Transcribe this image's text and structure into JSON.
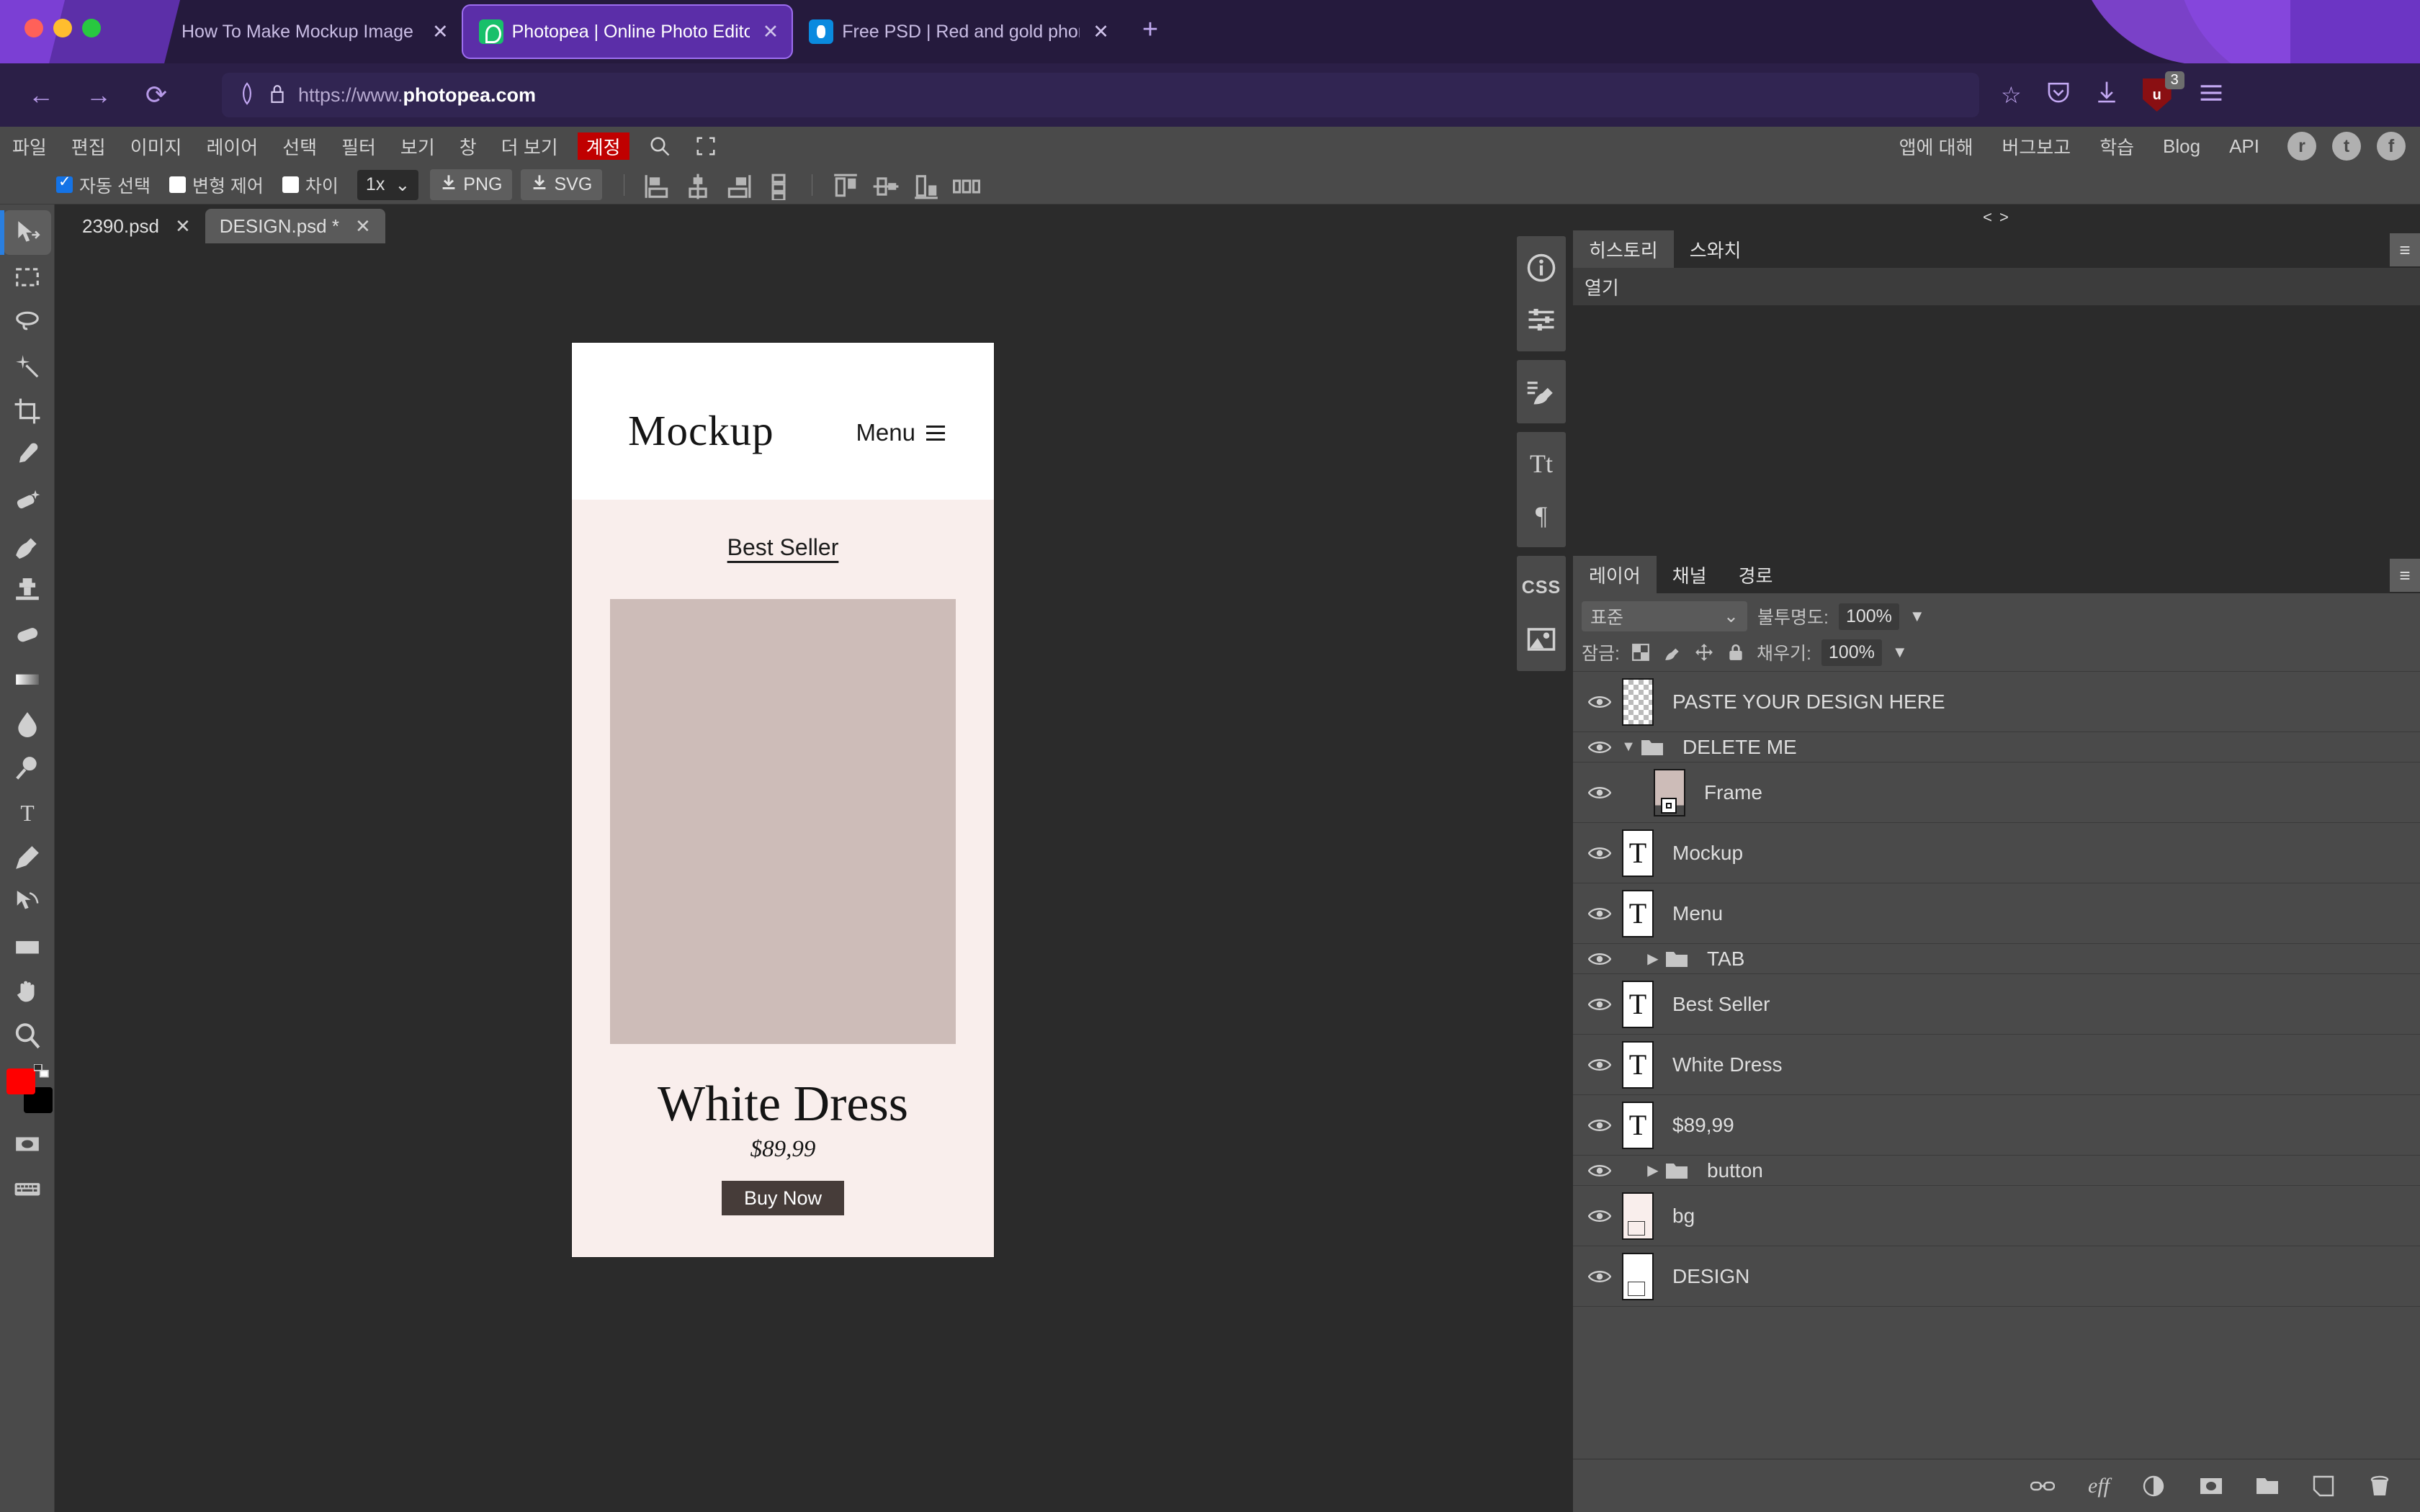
{
  "browser": {
    "tabs": [
      {
        "title": "How To Make Mockup Image · Devle",
        "favicon": "none",
        "active": false,
        "close": "✕"
      },
      {
        "title": "Photopea | Online Photo Editor",
        "favicon": "photopea-icon",
        "active": true,
        "close": "✕"
      },
      {
        "title": "Free PSD | Red and gold phone s",
        "favicon": "freepik-icon",
        "active": false,
        "close": "✕"
      }
    ],
    "new_tab_label": "+",
    "nav": {
      "back": "←",
      "forward": "→",
      "reload": "⟳"
    },
    "url": {
      "prefix": "https://www.",
      "domain": "photopea.com",
      "shield_icon": "tracking-shield-icon",
      "lock_icon": "lock-icon"
    },
    "toolbar_right": {
      "bookmark": "☆",
      "pocket": "pocket-icon",
      "download": "download-icon",
      "ublock_label": "u",
      "ublock_badge": "3",
      "menu": "hamburger-menu-icon"
    }
  },
  "photopea": {
    "menubar": {
      "items": [
        "파일",
        "편집",
        "이미지",
        "레이어",
        "선택",
        "필터",
        "보기",
        "창",
        "더 보기"
      ],
      "account": "계정",
      "search_icon": "search-icon",
      "fullscreen_icon": "fullscreen-icon",
      "right_links": [
        "앱에 대해",
        "버그보고",
        "학습",
        "Blog",
        "API"
      ],
      "social": [
        "reddit-icon",
        "twitter-icon",
        "facebook-icon"
      ]
    },
    "options": {
      "auto_select": {
        "label": "자동 선택",
        "checked": true
      },
      "transform_controls": {
        "label": "변형 제어",
        "checked": false
      },
      "difference": {
        "label": "차이",
        "checked": false
      },
      "scale": "1x",
      "export_png": "PNG",
      "export_svg": "SVG"
    },
    "doc_tabs": [
      {
        "name": "2390.psd",
        "active": false,
        "close": "✕"
      },
      {
        "name": "DESIGN.psd *",
        "active": true,
        "close": "✕"
      }
    ],
    "tools": [
      "move-tool",
      "marquee-tool",
      "lasso-tool",
      "magic-wand-tool",
      "crop-tool",
      "eyedropper-tool",
      "healing-brush-tool",
      "brush-tool",
      "clone-stamp-tool",
      "eraser-tool",
      "gradient-tool",
      "blur-tool",
      "dodge-tool",
      "type-tool",
      "pen-tool",
      "path-selection-tool",
      "rectangle-tool",
      "hand-tool",
      "zoom-tool"
    ],
    "swatches": {
      "foreground": "#ff0000",
      "background": "#000000"
    },
    "rail_icons": [
      "info-icon",
      "adjustments-icon",
      "brush-settings-icon",
      "character-icon",
      "paragraph-icon",
      "css-icon",
      "image-icon"
    ],
    "history_panel": {
      "tabs": [
        {
          "label": "히스토리",
          "active": true
        },
        {
          "label": "스와치",
          "active": false
        }
      ],
      "menu_icon": "panel-menu-icon",
      "items": [
        "열기"
      ]
    },
    "layers_panel": {
      "tabs": [
        {
          "label": "레이어",
          "active": true
        },
        {
          "label": "채널",
          "active": false
        },
        {
          "label": "경로",
          "active": false
        }
      ],
      "menu_icon": "panel-menu-icon",
      "blend_mode": "표준",
      "opacity_label": "불투명도:",
      "opacity_value": "100%",
      "lock_label": "잠금:",
      "lock_icons": [
        "lock-transparency-icon",
        "lock-pixels-icon",
        "lock-position-icon",
        "lock-all-icon"
      ],
      "fill_label": "채우기:",
      "fill_value": "100%",
      "layers": [
        {
          "name": "PASTE YOUR DESIGN HERE",
          "type": "raster",
          "thumb": "checker",
          "visible": true,
          "kind": "layer"
        },
        {
          "name": "DELETE ME",
          "type": "group",
          "expanded": true,
          "visible": true,
          "kind": "group"
        },
        {
          "name": "Frame",
          "type": "smart",
          "thumb": "frame",
          "visible": true,
          "kind": "layer",
          "indent": true
        },
        {
          "name": "Mockup",
          "type": "text",
          "thumb": "T",
          "visible": true,
          "kind": "layer"
        },
        {
          "name": "Menu",
          "type": "text",
          "thumb": "T",
          "visible": true,
          "kind": "layer"
        },
        {
          "name": "TAB",
          "type": "group",
          "expanded": false,
          "visible": true,
          "kind": "group"
        },
        {
          "name": "Best Seller",
          "type": "text",
          "thumb": "T",
          "visible": true,
          "kind": "layer"
        },
        {
          "name": "White Dress",
          "type": "text",
          "thumb": "T",
          "visible": true,
          "kind": "layer"
        },
        {
          "name": "$89,99",
          "type": "text",
          "thumb": "T",
          "visible": true,
          "kind": "layer"
        },
        {
          "name": "button",
          "type": "group",
          "expanded": false,
          "visible": true,
          "kind": "group"
        },
        {
          "name": "bg",
          "type": "raster",
          "thumb": "bg",
          "visible": true,
          "kind": "layer"
        },
        {
          "name": "DESIGN",
          "type": "raster",
          "thumb": "design",
          "visible": true,
          "kind": "layer"
        }
      ],
      "bottom_icons": [
        "link-layers-icon",
        "layer-effects-icon",
        "adjustment-layer-icon",
        "layer-mask-icon",
        "new-group-icon",
        "new-layer-icon",
        "delete-layer-icon"
      ]
    },
    "canvas": {
      "mockup": {
        "logo": "Mockup",
        "menu_label": "Menu",
        "menu_icon": "hamburger-icon",
        "best_seller": "Best Seller",
        "product_title": "White Dress",
        "price": "$89,99",
        "buy_button": "Buy Now",
        "colors": {
          "header_bg": "#ffffff",
          "body_bg": "#f9eeec",
          "photo": "#cdbcb8",
          "button": "#463c39"
        }
      }
    }
  }
}
